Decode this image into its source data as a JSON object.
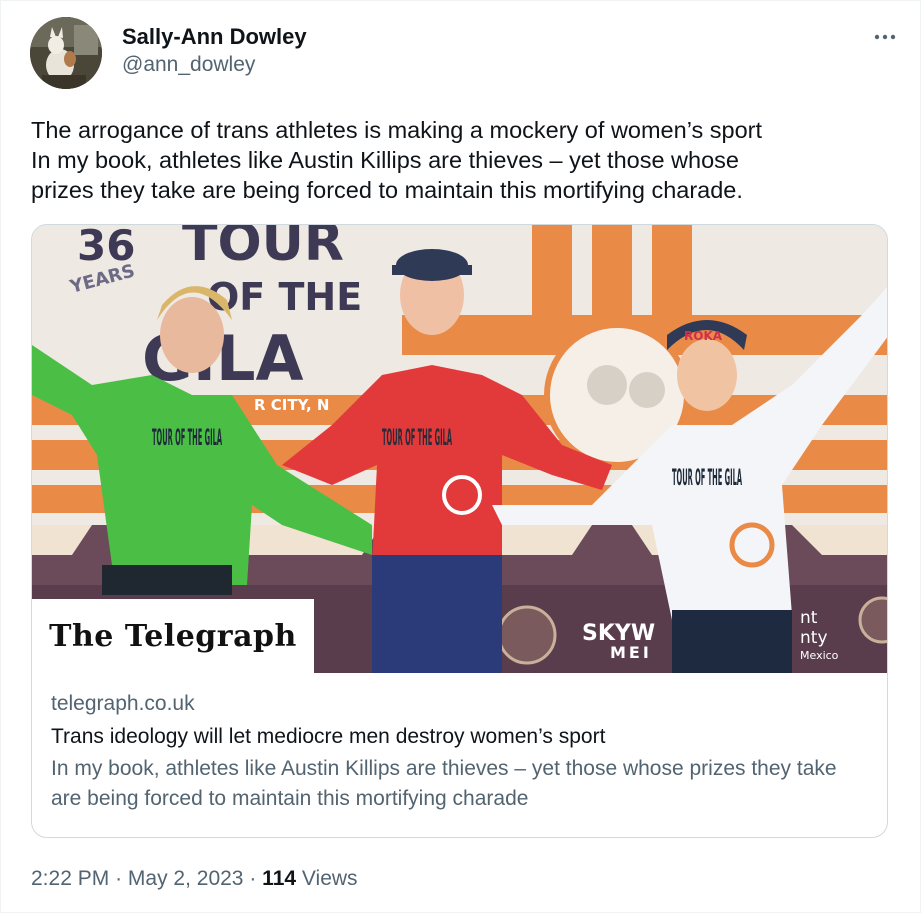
{
  "author": {
    "display_name": "Sally-Ann Dowley",
    "handle": "@ann_dowley"
  },
  "menu_icon": "more-horizontal-icon",
  "tweet_text": "The arrogance of trans athletes is making a mockery of women’s sport\nIn my book, athletes like Austin Killips are thieves – yet those whose\nprizes they take are being forced to maintain this mortifying charade.",
  "card": {
    "image_sign_text": [
      "36",
      "YEARS",
      "TOUR",
      "OF THE",
      "GILA",
      "R CITY, N"
    ],
    "jersey_text": [
      "TOUR OF THE GILA"
    ],
    "cap_text": "ROKA",
    "sponsor_text": [
      "SKYW",
      "MEI",
      "nt",
      "nty",
      "Mexico"
    ],
    "publisher": "The Telegraph",
    "domain": "telegraph.co.uk",
    "title": "Trans ideology will let mediocre men destroy women’s sport",
    "description": "In my book, athletes like Austin Killips are thieves – yet those whose prizes they take are being forced to maintain this mortifying charade"
  },
  "meta": {
    "time": "2:22 PM",
    "separator": "·",
    "date": "May 2, 2023",
    "views_count": "114",
    "views_label": "Views"
  },
  "colors": {
    "text_primary": "#0f1419",
    "text_secondary": "#536471",
    "border": "#cfd9de"
  }
}
